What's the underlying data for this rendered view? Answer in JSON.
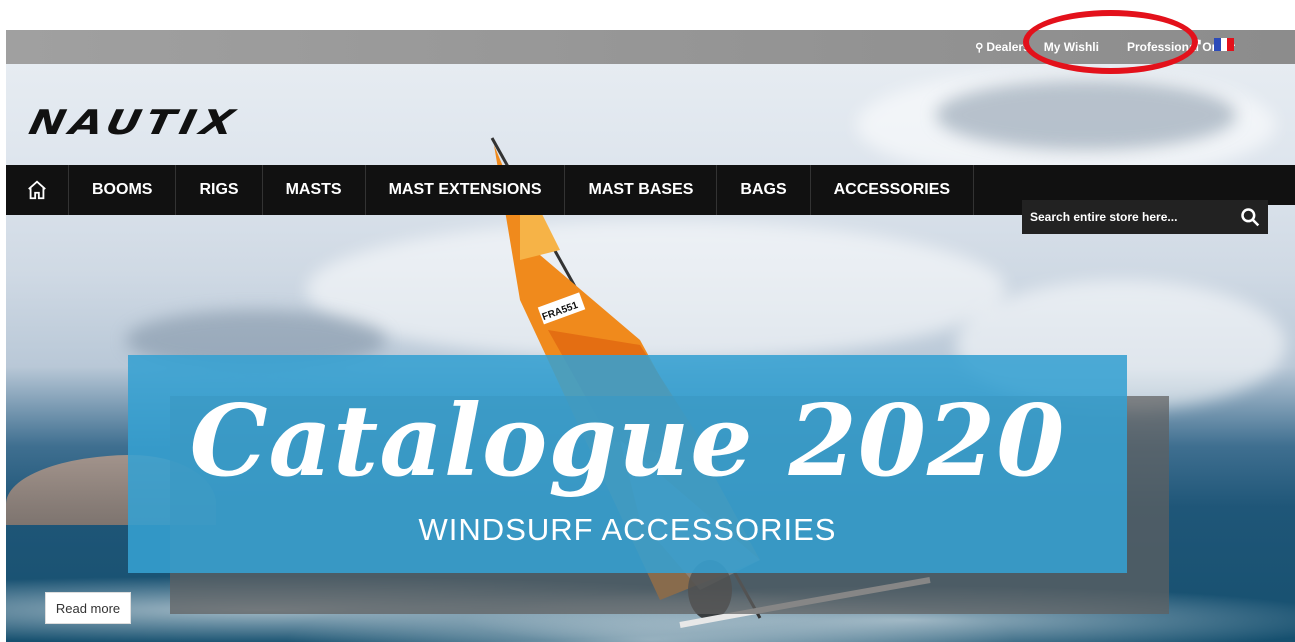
{
  "topbar": {
    "links": [
      {
        "label": "Dealers",
        "icon": "map-pin-icon"
      },
      {
        "label": "My Wishli"
      },
      {
        "label": "Professional Order"
      }
    ],
    "language_icons": [
      "uk-flag-icon",
      "french-flag-icon"
    ],
    "highlight_color": "#e3111b"
  },
  "brand": {
    "logo_text": "NAUTIX"
  },
  "nav": {
    "home_icon": "home-icon",
    "items": [
      "BOOMS",
      "RIGS",
      "MASTS",
      "MAST EXTENSIONS",
      "MAST BASES",
      "BAGS",
      "ACCESSORIES"
    ]
  },
  "search": {
    "placeholder": "Search entire store here...",
    "icon": "search-icon"
  },
  "hero": {
    "title": "Catalogue 2020",
    "subtitle": "WINDSURF ACCESSORIES",
    "cta": "Read more",
    "sail_number": "FRA551",
    "banner_color": "#35a0d2"
  }
}
